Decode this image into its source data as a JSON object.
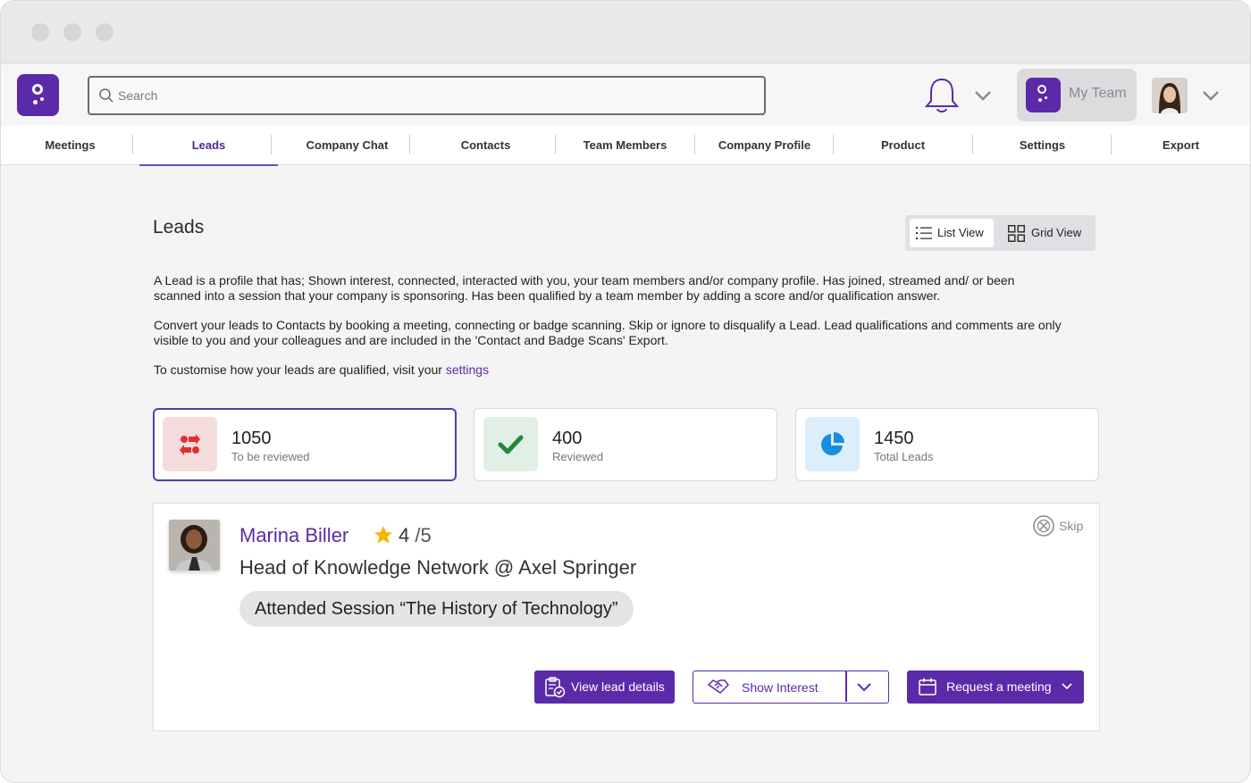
{
  "search": {
    "placeholder": "Search"
  },
  "header": {
    "team_label": "My Team"
  },
  "nav": {
    "items": [
      {
        "label": "Meetings"
      },
      {
        "label": "Leads"
      },
      {
        "label": "Company Chat"
      },
      {
        "label": "Contacts"
      },
      {
        "label": "Team Members"
      },
      {
        "label": "Company Profile"
      },
      {
        "label": "Product"
      },
      {
        "label": "Settings"
      },
      {
        "label": "Export"
      }
    ],
    "active": "Leads"
  },
  "page": {
    "title": "Leads",
    "list_view_label": "List View",
    "grid_view_label": "Grid View",
    "desc1_line1": "A Lead is a profile that has; Shown interest, connected,  interacted with you, your team members and/or company profile. Has joined, streamed and/ or been",
    "desc1_line2": "scanned into a session that your company is sponsoring. Has been qualified by a team member by adding a score and/or qualification answer.",
    "desc2_line1": "Convert your leads to Contacts by booking a meeting, connecting or badge scanning. Skip or ignore to disqualify a Lead. Lead qualifications and comments are only",
    "desc2_line2": "visible to you and your colleagues and are included in the 'Contact and Badge Scans' Export.",
    "desc3_text": "To customise how your leads are qualified, visit your ",
    "desc3_link": "settings"
  },
  "stats": [
    {
      "value": "1050",
      "label": "To be reviewed",
      "icon": "swap-arrows-icon",
      "color": "#e0312f"
    },
    {
      "value": "400",
      "label": "Reviewed",
      "icon": "checkmark-icon",
      "color": "#1f8a3b"
    },
    {
      "value": "1450",
      "label": "Total Leads",
      "icon": "pie-chart-icon",
      "color": "#1a8de0"
    }
  ],
  "lead": {
    "name": "Marina Biller",
    "score": "4",
    "score_max": " /5",
    "role": "Head of Knowledge Network @ Axel Springer",
    "session": "Attended Session “The History of Technology”",
    "skip_label": "Skip",
    "view_details_label": "View lead details",
    "show_interest_label": "Show Interest",
    "request_meeting_label": "Request a meeting"
  },
  "colors": {
    "brand": "#5b2aa8",
    "background": "#f4f4f5"
  }
}
